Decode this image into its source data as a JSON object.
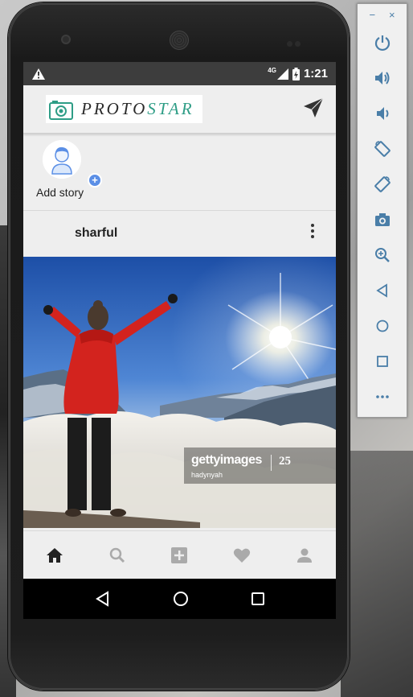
{
  "statusbar": {
    "network_label": "4G",
    "time": "1:21"
  },
  "appbar": {
    "logo_text_part1": "PROTO",
    "logo_text_part2": "STAR"
  },
  "stories": {
    "add_story_label": "Add story"
  },
  "post": {
    "username": "sharful",
    "watermark_brand": "gettyimages",
    "watermark_user": "hadynyah",
    "watermark_years": "25"
  },
  "bottom_nav": {
    "items": [
      "home-icon",
      "search-icon",
      "add-box-icon",
      "heart-icon",
      "person-icon"
    ]
  },
  "emulator_toolbar": {
    "minimize": "−",
    "close": "×",
    "buttons": [
      "power-icon",
      "volume-up-icon",
      "volume-down-icon",
      "rotate-left-icon",
      "rotate-right-icon",
      "camera-icon",
      "zoom-icon",
      "back-icon",
      "home-icon",
      "overview-icon",
      "more-icon"
    ]
  },
  "colors": {
    "accent_teal": "#2e9d86",
    "toolbar_blue": "#4a7ea8",
    "story_plus_blue": "#5b8fe6"
  }
}
